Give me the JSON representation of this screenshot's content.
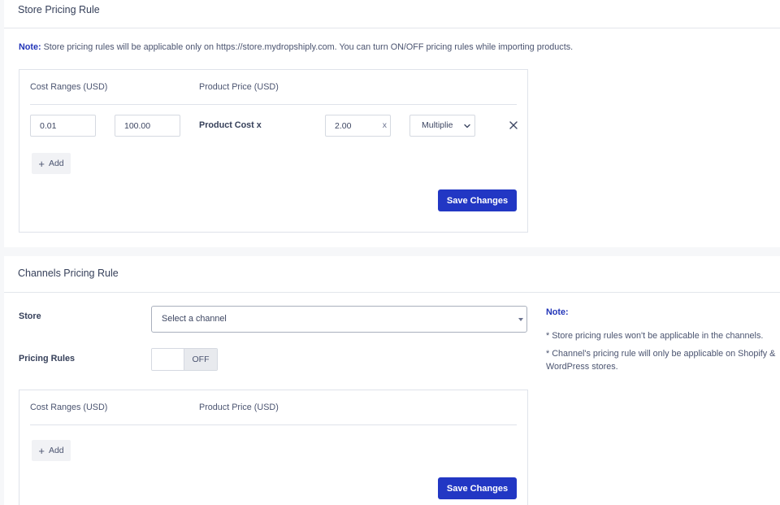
{
  "store_pricing": {
    "title": "Store Pricing Rule",
    "note_label": "Note:",
    "note_text": "Store pricing rules will be applicable only on https://store.mydropshiply.com. You can turn ON/OFF pricing rules while importing products.",
    "col_cost_ranges": "Cost Ranges (USD)",
    "col_product_price": "Product Price (USD)",
    "rules": [
      {
        "min": "0.01",
        "max": "100.00",
        "label": "Product Cost x",
        "factor": "2.00",
        "factor_suffix": "x",
        "operation": "Multiplie"
      }
    ],
    "add_label": "Add",
    "save_label": "Save Changes"
  },
  "channels_pricing": {
    "title": "Channels Pricing Rule",
    "store_label": "Store",
    "store_placeholder": "Select a channel",
    "pricing_rules_label": "Pricing Rules",
    "toggle_state": "OFF",
    "col_cost_ranges": "Cost Ranges (USD)",
    "col_product_price": "Product Price (USD)",
    "add_label": "Add",
    "save_label": "Save Changes",
    "side_note": {
      "title": "Note:",
      "line1": "* Store pricing rules won't be applicable in the channels.",
      "line2": "* Channel's pricing rule will only be applicable on Shopify & WordPress stores."
    }
  },
  "colors": {
    "primary": "#2237c4",
    "note_label": "#2134b8",
    "text": "#4b5470"
  }
}
